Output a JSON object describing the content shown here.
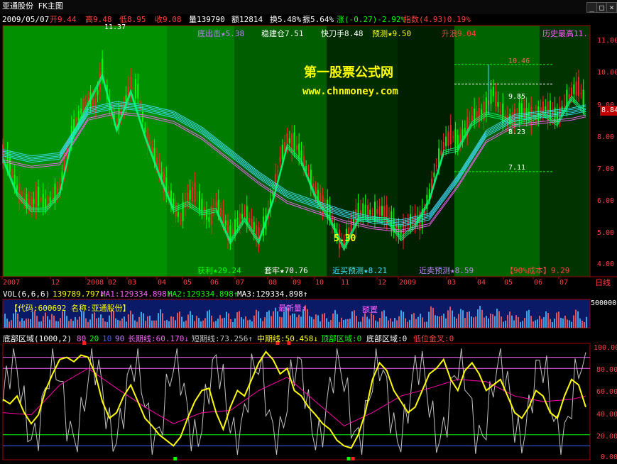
{
  "window": {
    "title": "亚通股份 FK主图",
    "min_label": "_",
    "restore_label": "□",
    "close_label": "×"
  },
  "quote_line": {
    "date": "2009/05/07",
    "open": "开9.44",
    "high": "高9.48",
    "low": "低8.95",
    "close": "收9.08",
    "volume": "量139790",
    "amount": "额12814",
    "turnover": "换5.48%",
    "amplitude": "振5.64%",
    "change": "涨(-0.27)-2.92%",
    "index": "指数(4.93)0.19%"
  },
  "signals_top": {
    "bottom_strike": "底出击★5.38",
    "steady": "稳建仓7.51",
    "fast_knife": "快刀手8.48",
    "predict": "预测★9.50",
    "rise": "升浪9.04",
    "hist_high": "历史最高11.",
    "peak_label": "11.37"
  },
  "signals_bottom": {
    "profit": "获利★29.24",
    "trapped": "套牢★70.76",
    "recent_buy": "近买预测★8.21",
    "recent_sell": "近卖预测★8.59",
    "cost90": "【90%成本】9.29",
    "low_label": "5.30"
  },
  "watermark": {
    "name": "第一股票公式网",
    "url": "www.chnmoney.com"
  },
  "price_axis": {
    "ticks": [
      "11.00",
      "10.00",
      "9.00",
      "8.00",
      "7.00",
      "6.00",
      "5.00",
      "4.00"
    ],
    "current": "8.84"
  },
  "annotations": {
    "high_line": "10.46",
    "mid_line": "9.85",
    "lower": "8.23",
    "low_line": "7.11"
  },
  "date_axis": {
    "labels": [
      "2007",
      "12",
      "2008",
      "02",
      "03",
      "04",
      "05",
      "06",
      "07",
      "08",
      "09",
      "10",
      "11",
      "12",
      "2009",
      "03",
      "04",
      "05",
      "06",
      "07"
    ],
    "period": "日线"
  },
  "vol_panel": {
    "header_name": "VOL(6,6,6)",
    "vol_value": "139789.797↓",
    "ma1": "MA1:129334.898↑",
    "ma2": "MA2:129334.898↑",
    "ma3": "MA3:129334.898↑",
    "code": "【代码:600692 名称:亚通股份】",
    "latest": "最新量↑",
    "eight": "额置",
    "axis": "500000"
  },
  "osc_panel": {
    "name": "底部区域(1000,2)",
    "levels": [
      "80",
      "20",
      "10",
      "90"
    ],
    "long": "长期线:60.170↓",
    "short": "短期线:73.256↑",
    "mid": "中期线:50.458↓",
    "top_zone": "顶部区域:0",
    "bottom_zone": "底部区域:0",
    "low_cross": "低位金叉:0",
    "axis": [
      "100.00",
      "80.00",
      "60.00",
      "40.00",
      "20.00",
      "0.00"
    ]
  },
  "colors": {
    "candle_up": "#ff2020",
    "candle_down": "#00ff00",
    "ma_cyan": "#40e0ff",
    "ma_pink": "#ff60ff",
    "ma_green": "#00ff80",
    "osc_yellow": "#ffff00",
    "osc_white": "#c0c0c0",
    "osc_magenta": "#ff00aa",
    "bg_green": "#008a00"
  },
  "chart_data": {
    "type": "line",
    "price_path": [
      [
        0,
        7.7
      ],
      [
        10,
        7.3
      ],
      [
        20,
        6.6
      ],
      [
        30,
        6.2
      ],
      [
        40,
        6.1
      ],
      [
        50,
        6.3
      ],
      [
        60,
        6.1
      ],
      [
        70,
        6.3
      ],
      [
        80,
        6.6
      ],
      [
        90,
        7.6
      ],
      [
        100,
        8.5
      ],
      [
        110,
        9.0
      ],
      [
        120,
        9.4
      ],
      [
        130,
        9.2
      ],
      [
        140,
        10.3
      ],
      [
        150,
        9.2
      ],
      [
        160,
        8.6
      ],
      [
        170,
        9.1
      ],
      [
        180,
        9.8
      ],
      [
        190,
        9.6
      ],
      [
        200,
        8.4
      ],
      [
        210,
        7.8
      ],
      [
        220,
        7.2
      ],
      [
        230,
        6.6
      ],
      [
        240,
        6.1
      ],
      [
        250,
        5.6
      ],
      [
        260,
        6.3
      ],
      [
        270,
        6.5
      ],
      [
        280,
        6.0
      ],
      [
        290,
        5.6
      ],
      [
        300,
        6.1
      ],
      [
        310,
        5.7
      ],
      [
        320,
        5.1
      ],
      [
        330,
        5.5
      ],
      [
        340,
        5.8
      ],
      [
        350,
        5.5
      ],
      [
        360,
        5.1
      ],
      [
        370,
        5.5
      ],
      [
        380,
        6.4
      ],
      [
        390,
        7.5
      ],
      [
        400,
        8.1
      ],
      [
        410,
        8.0
      ],
      [
        420,
        7.6
      ],
      [
        430,
        7.0
      ],
      [
        440,
        6.5
      ],
      [
        450,
        6.1
      ],
      [
        460,
        5.8
      ],
      [
        470,
        5.1
      ],
      [
        480,
        4.9
      ],
      [
        490,
        5.4
      ],
      [
        500,
        5.8
      ],
      [
        510,
        5.9
      ],
      [
        520,
        5.8
      ],
      [
        530,
        5.9
      ],
      [
        540,
        5.8
      ],
      [
        550,
        5.4
      ],
      [
        560,
        5.2
      ],
      [
        570,
        5.5
      ],
      [
        580,
        5.6
      ],
      [
        590,
        5.6
      ],
      [
        600,
        6.4
      ],
      [
        610,
        7.3
      ],
      [
        620,
        7.9
      ],
      [
        630,
        8.3
      ],
      [
        640,
        8.0
      ],
      [
        650,
        8.4
      ],
      [
        660,
        8.8
      ],
      [
        670,
        8.9
      ],
      [
        680,
        9.1
      ],
      [
        690,
        9.6
      ],
      [
        700,
        9.0
      ],
      [
        710,
        8.7
      ],
      [
        720,
        8.8
      ],
      [
        730,
        9.0
      ],
      [
        740,
        8.9
      ],
      [
        750,
        8.8
      ],
      [
        760,
        9.1
      ],
      [
        770,
        9.0
      ],
      [
        780,
        8.8
      ],
      [
        790,
        9.2
      ],
      [
        800,
        9.6
      ],
      [
        810,
        9.8
      ],
      [
        820,
        9.1
      ]
    ],
    "ma_long": [
      [
        0,
        7.6
      ],
      [
        40,
        7.4
      ],
      [
        80,
        7.5
      ],
      [
        120,
        8.9
      ],
      [
        160,
        9.1
      ],
      [
        200,
        9.0
      ],
      [
        240,
        8.8
      ],
      [
        280,
        8.3
      ],
      [
        320,
        7.6
      ],
      [
        360,
        6.9
      ],
      [
        380,
        6.6
      ],
      [
        400,
        6.3
      ],
      [
        440,
        6.0
      ],
      [
        480,
        5.7
      ],
      [
        520,
        5.5
      ],
      [
        560,
        5.4
      ],
      [
        600,
        5.6
      ],
      [
        640,
        6.8
      ],
      [
        680,
        8.2
      ],
      [
        720,
        8.7
      ],
      [
        760,
        8.8
      ],
      [
        800,
        8.9
      ],
      [
        820,
        9.0
      ]
    ],
    "osc_short": [
      [
        0,
        52
      ],
      [
        10,
        48
      ],
      [
        20,
        55
      ],
      [
        30,
        40
      ],
      [
        40,
        30
      ],
      [
        50,
        38
      ],
      [
        60,
        60
      ],
      [
        70,
        75
      ],
      [
        80,
        88
      ],
      [
        90,
        90
      ],
      [
        100,
        86
      ],
      [
        110,
        92
      ],
      [
        120,
        90
      ],
      [
        130,
        75
      ],
      [
        140,
        50
      ],
      [
        150,
        35
      ],
      [
        160,
        40
      ],
      [
        170,
        55
      ],
      [
        180,
        65
      ],
      [
        190,
        50
      ],
      [
        200,
        35
      ],
      [
        210,
        28
      ],
      [
        220,
        20
      ],
      [
        230,
        15
      ],
      [
        240,
        10
      ],
      [
        250,
        18
      ],
      [
        260,
        35
      ],
      [
        270,
        50
      ],
      [
        280,
        60
      ],
      [
        290,
        62
      ],
      [
        300,
        40
      ],
      [
        310,
        25
      ],
      [
        320,
        45
      ],
      [
        330,
        60
      ],
      [
        340,
        55
      ],
      [
        350,
        70
      ],
      [
        360,
        85
      ],
      [
        370,
        95
      ],
      [
        380,
        88
      ],
      [
        390,
        75
      ],
      [
        400,
        80
      ],
      [
        410,
        60
      ],
      [
        420,
        55
      ],
      [
        430,
        45
      ],
      [
        440,
        38
      ],
      [
        450,
        30
      ],
      [
        460,
        25
      ],
      [
        470,
        15
      ],
      [
        480,
        10
      ],
      [
        490,
        8
      ],
      [
        500,
        20
      ],
      [
        510,
        40
      ],
      [
        520,
        70
      ],
      [
        530,
        85
      ],
      [
        540,
        78
      ],
      [
        550,
        60
      ],
      [
        560,
        50
      ],
      [
        570,
        40
      ],
      [
        580,
        45
      ],
      [
        590,
        60
      ],
      [
        600,
        75
      ],
      [
        610,
        80
      ],
      [
        620,
        88
      ],
      [
        630,
        70
      ],
      [
        640,
        60
      ],
      [
        650,
        78
      ],
      [
        660,
        85
      ],
      [
        670,
        75
      ],
      [
        680,
        60
      ],
      [
        690,
        65
      ],
      [
        700,
        70
      ],
      [
        710,
        55
      ],
      [
        720,
        40
      ],
      [
        730,
        35
      ],
      [
        740,
        45
      ],
      [
        750,
        60
      ],
      [
        760,
        55
      ],
      [
        770,
        40
      ],
      [
        780,
        35
      ],
      [
        790,
        55
      ],
      [
        800,
        70
      ],
      [
        810,
        65
      ],
      [
        820,
        45
      ]
    ],
    "osc_long": [
      [
        0,
        40
      ],
      [
        40,
        38
      ],
      [
        80,
        65
      ],
      [
        120,
        80
      ],
      [
        160,
        62
      ],
      [
        200,
        45
      ],
      [
        240,
        30
      ],
      [
        280,
        40
      ],
      [
        320,
        42
      ],
      [
        360,
        60
      ],
      [
        400,
        72
      ],
      [
        440,
        50
      ],
      [
        480,
        28
      ],
      [
        520,
        40
      ],
      [
        560,
        55
      ],
      [
        600,
        62
      ],
      [
        640,
        70
      ],
      [
        680,
        68
      ],
      [
        720,
        55
      ],
      [
        760,
        50
      ],
      [
        800,
        52
      ],
      [
        820,
        55
      ]
    ],
    "price_range": [
      4.0,
      11.5
    ],
    "osc_range": [
      0,
      100
    ]
  }
}
